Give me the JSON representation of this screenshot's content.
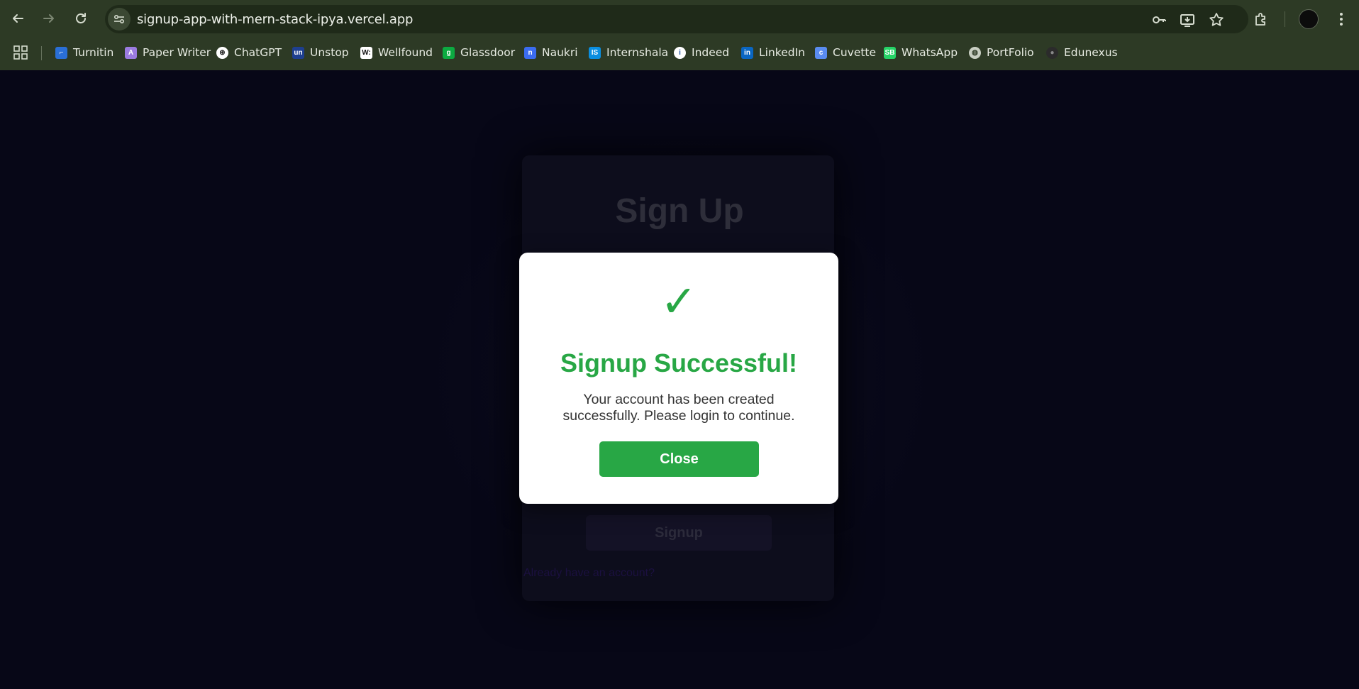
{
  "browser": {
    "url": "signup-app-with-mern-stack-ipya.vercel.app",
    "bookmarks": [
      {
        "label": "Turnitin",
        "icon": "turnitin-icon",
        "color": "#2a6fd6"
      },
      {
        "label": "Paper Writer",
        "icon": "paper-writer-icon",
        "color": "#9b7be0"
      },
      {
        "label": "ChatGPT",
        "icon": "chatgpt-icon",
        "color": "#ffffff"
      },
      {
        "label": "Unstop",
        "icon": "unstop-icon",
        "color": "#1e3f8f"
      },
      {
        "label": "Wellfound",
        "icon": "wellfound-icon",
        "color": "#ffffff"
      },
      {
        "label": "Glassdoor",
        "icon": "glassdoor-icon",
        "color": "#0caa41"
      },
      {
        "label": "Naukri",
        "icon": "naukri-icon",
        "color": "#3b6cf0"
      },
      {
        "label": "Internshala",
        "icon": "internshala-icon",
        "color": "#0a8ee0"
      },
      {
        "label": "Indeed",
        "icon": "indeed-icon",
        "color": "#ffffff"
      },
      {
        "label": "LinkedIn",
        "icon": "linkedin-icon",
        "color": "#0a66c2"
      },
      {
        "label": "Cuvette",
        "icon": "cuvette-icon",
        "color": "#5a8cf0"
      },
      {
        "label": "WhatsApp",
        "icon": "whatsapp-icon",
        "color": "#25d366"
      },
      {
        "label": "PortFolio",
        "icon": "globe-icon",
        "color": "#c9cfc3"
      },
      {
        "label": "Edunexus",
        "icon": "github-icon",
        "color": "#2b2b2b"
      }
    ]
  },
  "page": {
    "form_title": "Sign Up",
    "submit_label": "Signup",
    "link_text": "Already have an account?"
  },
  "modal": {
    "check": "✓",
    "title": "Signup Successful!",
    "message": "Your account has been created successfully. Please login to continue.",
    "close_label": "Close",
    "accent": "#28a745"
  }
}
